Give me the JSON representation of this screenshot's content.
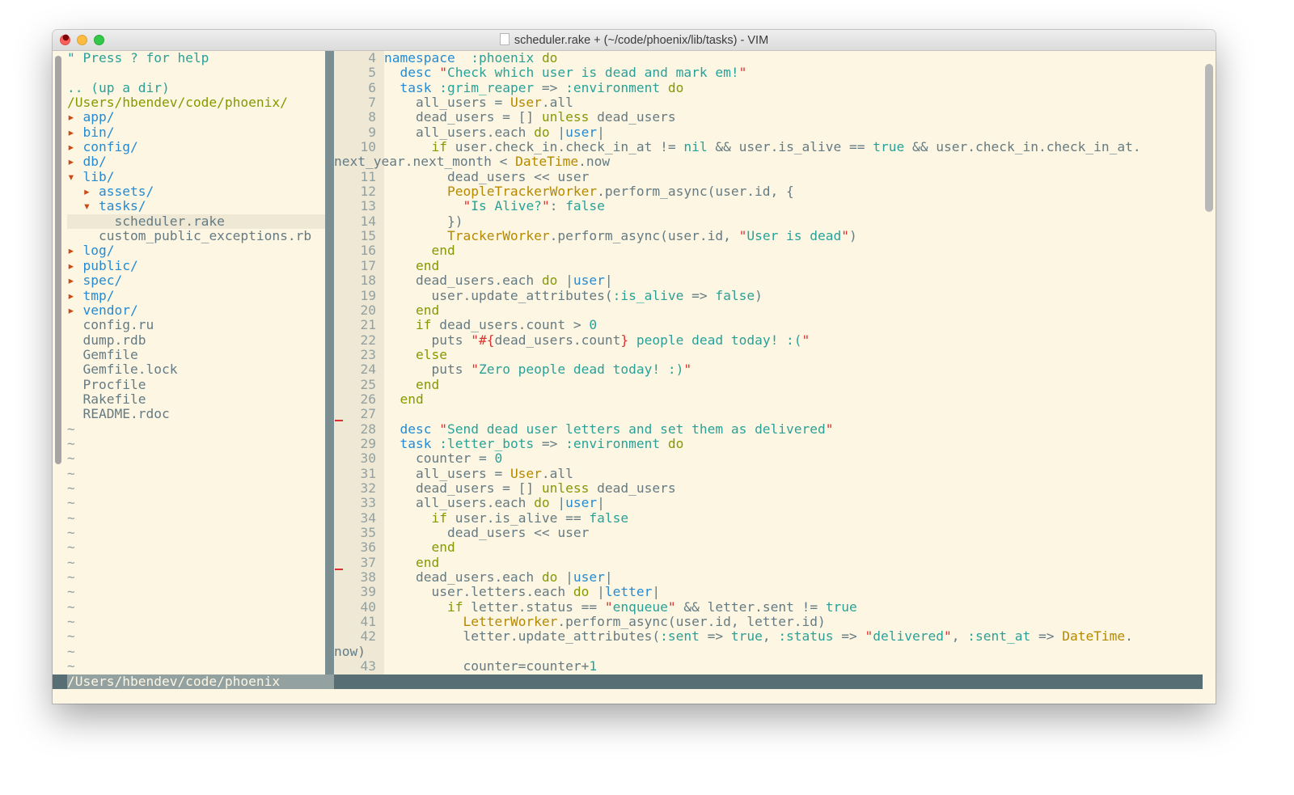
{
  "window": {
    "title": "scheduler.rake + (~/code/phoenix/lib/tasks) - VIM"
  },
  "nerdtree": {
    "help": "\" Press ? for help",
    "up_dir": ".. (up a dir)",
    "root": "/Users/hbendev/code/phoenix/",
    "entries": [
      {
        "indent": 0,
        "arrow": "▸",
        "name": "app/",
        "type": "dir"
      },
      {
        "indent": 0,
        "arrow": "▸",
        "name": "bin/",
        "type": "dir"
      },
      {
        "indent": 0,
        "arrow": "▸",
        "name": "config/",
        "type": "dir"
      },
      {
        "indent": 0,
        "arrow": "▸",
        "name": "db/",
        "type": "dir"
      },
      {
        "indent": 0,
        "arrow": "▾",
        "name": "lib/",
        "type": "dir"
      },
      {
        "indent": 1,
        "arrow": "▸",
        "name": "assets/",
        "type": "dir"
      },
      {
        "indent": 1,
        "arrow": "▾",
        "name": "tasks/",
        "type": "dir"
      },
      {
        "indent": 2,
        "arrow": "",
        "name": "scheduler.rake",
        "type": "file",
        "selected": true
      },
      {
        "indent": 1,
        "arrow": "",
        "name": "custom_public_exceptions.rb",
        "type": "file"
      },
      {
        "indent": 0,
        "arrow": "▸",
        "name": "log/",
        "type": "dir"
      },
      {
        "indent": 0,
        "arrow": "▸",
        "name": "public/",
        "type": "dir"
      },
      {
        "indent": 0,
        "arrow": "▸",
        "name": "spec/",
        "type": "dir"
      },
      {
        "indent": 0,
        "arrow": "▸",
        "name": "tmp/",
        "type": "dir"
      },
      {
        "indent": 0,
        "arrow": "▸",
        "name": "vendor/",
        "type": "dir"
      },
      {
        "indent": 0,
        "arrow": "",
        "name": "config.ru",
        "type": "file"
      },
      {
        "indent": 0,
        "arrow": "",
        "name": "dump.rdb",
        "type": "file"
      },
      {
        "indent": 0,
        "arrow": "",
        "name": "Gemfile",
        "type": "file"
      },
      {
        "indent": 0,
        "arrow": "",
        "name": "Gemfile.lock",
        "type": "file"
      },
      {
        "indent": 0,
        "arrow": "",
        "name": "Procfile",
        "type": "file"
      },
      {
        "indent": 0,
        "arrow": "",
        "name": "Rakefile",
        "type": "file"
      },
      {
        "indent": 0,
        "arrow": "",
        "name": "README.rdoc",
        "type": "file"
      }
    ],
    "tilde_count": 17,
    "status_path": "/Users/hbendev/code/phoenix"
  },
  "editor": {
    "diff_marks_after_lines": [
      27,
      37
    ],
    "lines": [
      {
        "n": "4",
        "t": [
          [
            "kb",
            "namespace"
          ],
          [
            "",
            "  "
          ],
          [
            "sym",
            ":phoenix"
          ],
          [
            "",
            " "
          ],
          [
            "kw",
            "do"
          ]
        ]
      },
      {
        "n": "5",
        "t": [
          [
            "",
            "  "
          ],
          [
            "kb",
            "desc"
          ],
          [
            "",
            " "
          ],
          [
            "sd",
            "\""
          ],
          [
            "str",
            "Check which user is dead and mark em!"
          ],
          [
            "sd",
            "\""
          ]
        ]
      },
      {
        "n": "6",
        "t": [
          [
            "",
            "  "
          ],
          [
            "kb",
            "task"
          ],
          [
            "",
            " "
          ],
          [
            "sym",
            ":grim_reaper"
          ],
          [
            "",
            " => "
          ],
          [
            "sym",
            ":environment"
          ],
          [
            "",
            " "
          ],
          [
            "kw",
            "do"
          ]
        ]
      },
      {
        "n": "7",
        "t": [
          [
            "",
            "    all_users = "
          ],
          [
            "cls",
            "User"
          ],
          [
            "",
            ".all"
          ]
        ]
      },
      {
        "n": "8",
        "t": [
          [
            "",
            "    dead_users = [] "
          ],
          [
            "kw",
            "unless"
          ],
          [
            "",
            " dead_users"
          ]
        ]
      },
      {
        "n": "9",
        "t": [
          [
            "",
            "    all_users.each "
          ],
          [
            "kw",
            "do"
          ],
          [
            "",
            " |"
          ],
          [
            "var",
            "user"
          ],
          [
            "",
            "|"
          ]
        ]
      },
      {
        "n": "10",
        "t": [
          [
            "",
            "      "
          ],
          [
            "kw",
            "if"
          ],
          [
            "",
            " user.check_in.check_in_at != "
          ],
          [
            "bool",
            "nil"
          ],
          [
            "",
            " && user.is_alive == "
          ],
          [
            "bool",
            "true"
          ],
          [
            "",
            " && user.check_in.check_in_at."
          ]
        ]
      },
      {
        "n": "",
        "t": [
          [
            "",
            "next_year.next_month < "
          ],
          [
            "cls",
            "DateTime"
          ],
          [
            "",
            ".now"
          ]
        ]
      },
      {
        "n": "11",
        "t": [
          [
            "",
            "        dead_users << user"
          ]
        ]
      },
      {
        "n": "12",
        "t": [
          [
            "",
            "        "
          ],
          [
            "cls",
            "PeopleTrackerWorker"
          ],
          [
            "",
            ".perform_async(user.id, {"
          ]
        ]
      },
      {
        "n": "13",
        "t": [
          [
            "",
            "          "
          ],
          [
            "sd",
            "\""
          ],
          [
            "str",
            "Is Alive?"
          ],
          [
            "sd",
            "\""
          ],
          [
            "",
            ": "
          ],
          [
            "bool",
            "false"
          ]
        ]
      },
      {
        "n": "14",
        "t": [
          [
            "",
            "        })"
          ]
        ]
      },
      {
        "n": "15",
        "t": [
          [
            "",
            "        "
          ],
          [
            "cls",
            "TrackerWorker"
          ],
          [
            "",
            ".perform_async(user.id, "
          ],
          [
            "sd",
            "\""
          ],
          [
            "str",
            "User is dead"
          ],
          [
            "sd",
            "\""
          ],
          [
            "",
            ")"
          ]
        ]
      },
      {
        "n": "16",
        "t": [
          [
            "",
            "      "
          ],
          [
            "kw",
            "end"
          ]
        ]
      },
      {
        "n": "17",
        "t": [
          [
            "",
            "    "
          ],
          [
            "kw",
            "end"
          ]
        ]
      },
      {
        "n": "18",
        "t": [
          [
            "",
            "    dead_users.each "
          ],
          [
            "kw",
            "do"
          ],
          [
            "",
            " |"
          ],
          [
            "var",
            "user"
          ],
          [
            "",
            "|"
          ]
        ]
      },
      {
        "n": "19",
        "t": [
          [
            "",
            "      user.update_attributes("
          ],
          [
            "sym",
            ":is_alive"
          ],
          [
            "",
            " => "
          ],
          [
            "bool",
            "false"
          ],
          [
            "",
            ")"
          ]
        ]
      },
      {
        "n": "20",
        "t": [
          [
            "",
            "    "
          ],
          [
            "kw",
            "end"
          ]
        ]
      },
      {
        "n": "21",
        "t": [
          [
            "",
            "    "
          ],
          [
            "kw",
            "if"
          ],
          [
            "",
            " dead_users.count > "
          ],
          [
            "num",
            "0"
          ]
        ]
      },
      {
        "n": "22",
        "t": [
          [
            "",
            "      puts "
          ],
          [
            "sd",
            "\""
          ],
          [
            "interp",
            "#{"
          ],
          [
            "",
            "dead_users.count"
          ],
          [
            "interp",
            "}"
          ],
          [
            "str",
            " people dead today! :("
          ],
          [
            "sd",
            "\""
          ]
        ]
      },
      {
        "n": "23",
        "t": [
          [
            "",
            "    "
          ],
          [
            "kw",
            "else"
          ]
        ]
      },
      {
        "n": "24",
        "t": [
          [
            "",
            "      puts "
          ],
          [
            "sd",
            "\""
          ],
          [
            "str",
            "Zero people dead today! :)"
          ],
          [
            "sd",
            "\""
          ]
        ]
      },
      {
        "n": "25",
        "t": [
          [
            "",
            "    "
          ],
          [
            "kw",
            "end"
          ]
        ]
      },
      {
        "n": "26",
        "t": [
          [
            "",
            "  "
          ],
          [
            "kw",
            "end"
          ]
        ]
      },
      {
        "n": "27",
        "t": [
          [
            "",
            ""
          ]
        ]
      },
      {
        "n": "28",
        "t": [
          [
            "",
            "  "
          ],
          [
            "kb",
            "desc"
          ],
          [
            "",
            " "
          ],
          [
            "sd",
            "\""
          ],
          [
            "str",
            "Send dead user letters and set them as delivered"
          ],
          [
            "sd",
            "\""
          ]
        ]
      },
      {
        "n": "29",
        "t": [
          [
            "",
            "  "
          ],
          [
            "kb",
            "task"
          ],
          [
            "",
            " "
          ],
          [
            "sym",
            ":letter_bots"
          ],
          [
            "",
            " => "
          ],
          [
            "sym",
            ":environment"
          ],
          [
            "",
            " "
          ],
          [
            "kw",
            "do"
          ]
        ]
      },
      {
        "n": "30",
        "t": [
          [
            "",
            "    counter = "
          ],
          [
            "num",
            "0"
          ]
        ]
      },
      {
        "n": "31",
        "t": [
          [
            "",
            "    all_users = "
          ],
          [
            "cls",
            "User"
          ],
          [
            "",
            ".all"
          ]
        ]
      },
      {
        "n": "32",
        "t": [
          [
            "",
            "    dead_users = [] "
          ],
          [
            "kw",
            "unless"
          ],
          [
            "",
            " dead_users"
          ]
        ]
      },
      {
        "n": "33",
        "t": [
          [
            "",
            "    all_users.each "
          ],
          [
            "kw",
            "do"
          ],
          [
            "",
            " |"
          ],
          [
            "var",
            "user"
          ],
          [
            "",
            "|"
          ]
        ]
      },
      {
        "n": "34",
        "t": [
          [
            "",
            "      "
          ],
          [
            "kw",
            "if"
          ],
          [
            "",
            " user.is_alive == "
          ],
          [
            "bool",
            "false"
          ]
        ]
      },
      {
        "n": "35",
        "t": [
          [
            "",
            "        dead_users << user"
          ]
        ]
      },
      {
        "n": "36",
        "t": [
          [
            "",
            "      "
          ],
          [
            "kw",
            "end"
          ]
        ]
      },
      {
        "n": "37",
        "t": [
          [
            "",
            "    "
          ],
          [
            "kw",
            "end"
          ]
        ]
      },
      {
        "n": "38",
        "t": [
          [
            "",
            "    dead_users.each "
          ],
          [
            "kw",
            "do"
          ],
          [
            "",
            " |"
          ],
          [
            "var",
            "user"
          ],
          [
            "",
            "|"
          ]
        ]
      },
      {
        "n": "39",
        "t": [
          [
            "",
            "      user.letters.each "
          ],
          [
            "kw",
            "do"
          ],
          [
            "",
            " |"
          ],
          [
            "var",
            "letter"
          ],
          [
            "",
            "|"
          ]
        ]
      },
      {
        "n": "40",
        "t": [
          [
            "",
            "        "
          ],
          [
            "kw",
            "if"
          ],
          [
            "",
            " letter.status == "
          ],
          [
            "sd",
            "\""
          ],
          [
            "str",
            "enqueue"
          ],
          [
            "sd",
            "\""
          ],
          [
            "",
            " && letter.sent != "
          ],
          [
            "bool",
            "true"
          ]
        ]
      },
      {
        "n": "41",
        "t": [
          [
            "",
            "          "
          ],
          [
            "cls",
            "LetterWorker"
          ],
          [
            "",
            ".perform_async(user.id, letter.id)"
          ]
        ]
      },
      {
        "n": "42",
        "t": [
          [
            "",
            "          letter.update_attributes("
          ],
          [
            "sym",
            ":sent"
          ],
          [
            "",
            " => "
          ],
          [
            "bool",
            "true"
          ],
          [
            "",
            ", "
          ],
          [
            "sym",
            ":status"
          ],
          [
            "",
            " => "
          ],
          [
            "sd",
            "\""
          ],
          [
            "str",
            "delivered"
          ],
          [
            "sd",
            "\""
          ],
          [
            "",
            ", "
          ],
          [
            "sym",
            ":sent_at"
          ],
          [
            "",
            " => "
          ],
          [
            "cls",
            "DateTime"
          ],
          [
            "",
            "."
          ]
        ]
      },
      {
        "n": "",
        "t": [
          [
            "",
            "now)"
          ]
        ]
      },
      {
        "n": "43",
        "t": [
          [
            "",
            "          counter=counter+"
          ],
          [
            "num",
            "1"
          ]
        ]
      }
    ]
  }
}
